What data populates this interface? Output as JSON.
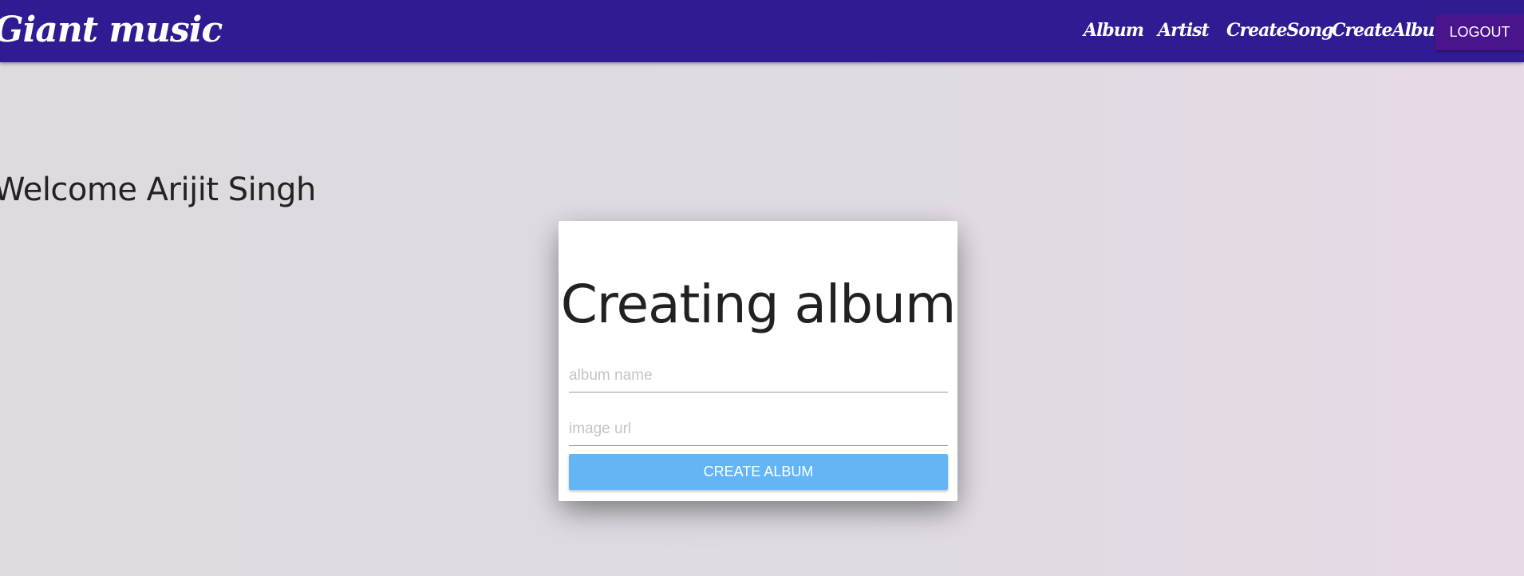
{
  "navbar": {
    "brand": "Giant music",
    "links": [
      "Album",
      "Artist",
      "CreateSong",
      "CreateAlbum"
    ],
    "logout_label": "LOGOUT",
    "colors": {
      "background": "#311b92",
      "logout_background": "#4a148c"
    }
  },
  "main": {
    "welcome_text": "Welcome Arijit Singh"
  },
  "form": {
    "title": "Creating album",
    "album_name": {
      "value": "",
      "placeholder": "album name"
    },
    "image_url": {
      "value": "",
      "placeholder": "image url"
    },
    "submit_label": "CREATE ALBUM",
    "colors": {
      "submit_background": "#64b5f6"
    }
  }
}
